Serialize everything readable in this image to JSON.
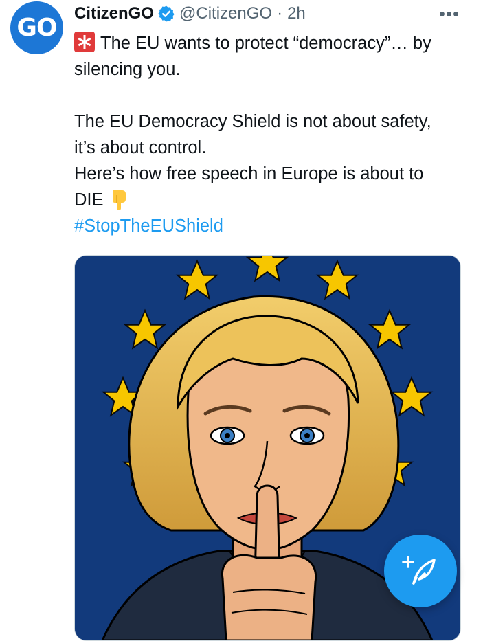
{
  "author": {
    "avatar_text": "GO",
    "display_name": "CitizenGO",
    "handle": "@CitizenGO",
    "separator": "·",
    "time": "2h"
  },
  "menu": {
    "more_icon": "more-horizontal-icon",
    "more_text": "•••"
  },
  "tweet": {
    "line1": "The EU wants to protect “democracy”… by",
    "line2": "silencing you.",
    "line3": "The EU Democracy Shield is not about safety,",
    "line4": "it’s about control.",
    "line5": "Here’s how free speech in Europe is about to",
    "line6": "DIE",
    "hashtag": "#StopTheEUShield"
  },
  "icons": {
    "verified": "verified-badge-icon",
    "siren": "police-light-icon",
    "pointing_down": "backhand-index-pointing-down-icon",
    "compose": "compose-feather-icon"
  },
  "colors": {
    "accent": "#1d9bf0",
    "avatar_bg": "#1d77d6",
    "secondary_text": "#536471",
    "eu_blue": "#123a7c",
    "eu_star": "#f7c600"
  }
}
